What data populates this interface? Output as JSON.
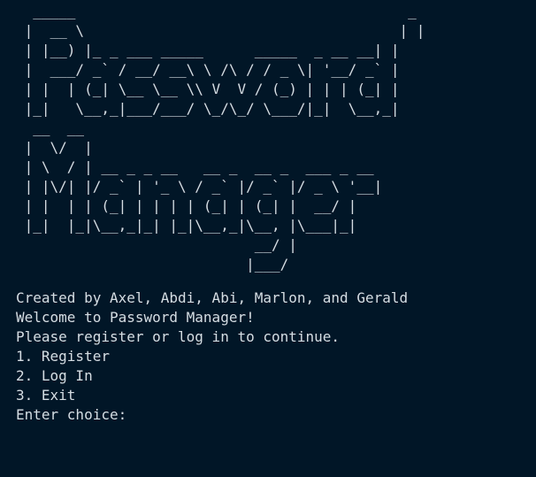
{
  "colors": {
    "background": "#011627",
    "text": "#d6dde3"
  },
  "banner": {
    "ascii_title": "  _____                                       _ \n |  __ \\                                     | |\n | |__) |_ _ ___ _____      _____  _ __ __| |\n |  ___/ _` / __/ __\\ \\ /\\ / / _ \\| '__/ _` |\n | |  | (_| \\__ \\__ \\\\ V  V / (_) | | | (_| |\n |_|   \\__,_|___/___/ \\_/\\_/ \\___/|_|  \\__,_|\n  __  __                                   \n |  \\/  |                                  \n | \\  / | __ _ _ __   __ _  __ _  ___ _ __ \n | |\\/| |/ _` | '_ \\ / _` |/ _` |/ _ \\ '__|\n | |  | | (_| | | | | (_| | (_| |  __/ |   \n |_|  |_|\\__,_|_| |_|\\__,_|\\__, |\\___|_|   \n                            __/ |          \n                           |___/           "
  },
  "output": {
    "credits": "Created by Axel, Abdi, Abi, Marlon, and Gerald",
    "welcome": "Welcome to Password Manager!",
    "instruction": "Please register or log in to continue.",
    "menu": [
      "1. Register",
      "2. Log In",
      "3. Exit"
    ],
    "prompt": "Enter choice:"
  }
}
